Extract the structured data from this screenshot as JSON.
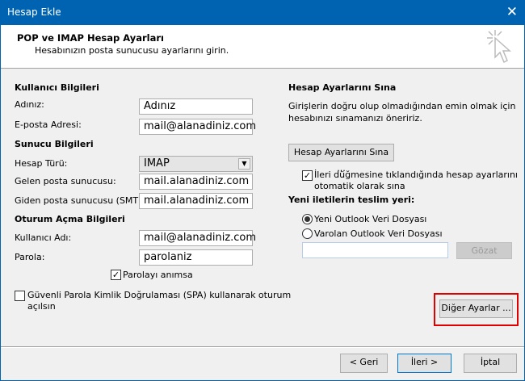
{
  "window": {
    "title": "Hesap Ekle"
  },
  "header": {
    "title": "POP ve IMAP Hesap Ayarları",
    "subtitle": "Hesabınızın posta sunucusu ayarlarını girin."
  },
  "user": {
    "section": "Kullanıcı Bilgileri",
    "name_label": "Adınız:",
    "name_value": "Adınız",
    "email_label": "E-posta Adresi:",
    "email_value": "mail@alanadiniz.com"
  },
  "server": {
    "section": "Sunucu Bilgileri",
    "type_label": "Hesap Türü:",
    "type_value": "IMAP",
    "incoming_label": "Gelen posta sunucusu:",
    "incoming_value": "mail.alanadiniz.com",
    "outgoing_label": "Giden posta sunucusu (SMTP):",
    "outgoing_value": "mail.alanadiniz.com"
  },
  "login": {
    "section": "Oturum Açma Bilgileri",
    "username_label": "Kullanıcı Adı:",
    "username_value": "mail@alanadiniz.com",
    "password_label": "Parola:",
    "password_value": "parolaniz",
    "remember_label": "Parolayı anımsa",
    "remember_checked": true,
    "spa_label_1": "Güvenli Parola Kimlik Doğrulaması (SPA) kullanarak oturum",
    "spa_label_2": "açılsın",
    "spa_checked": false
  },
  "test": {
    "section": "Hesap Ayarlarını Sına",
    "desc_1": "Girişlerin doğru olup olmadığından emin olmak için",
    "desc_2": "hesabınızı sınamanızı öneririz.",
    "button": "Hesap Ayarlarını Sına ...",
    "auto_label_1": "İleri düğmesine tıklandığında hesap ayarlarını",
    "auto_label_2": "otomatik olarak sına",
    "auto_checked": true
  },
  "delivery": {
    "section": "Yeni iletilerin teslim yeri:",
    "option_new": "Yeni Outlook Veri Dosyası",
    "option_existing": "Varolan Outlook Veri Dosyası",
    "selected": "new",
    "path_value": "",
    "browse": "Gözat"
  },
  "more_settings": "Diğer Ayarlar ...",
  "highlight_color": "#e00000",
  "footer": {
    "back": "< Geri",
    "next": "İleri >",
    "cancel": "İptal"
  }
}
